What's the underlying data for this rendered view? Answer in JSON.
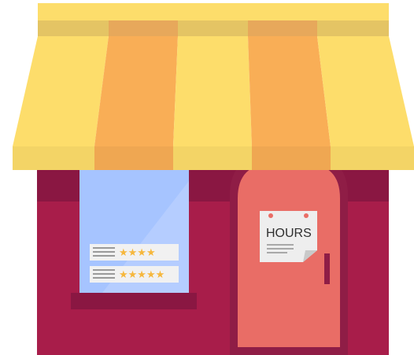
{
  "storefront": {
    "hours_sign": {
      "label": "HOURS"
    },
    "reviews": [
      {
        "stars_shown": "★★★★",
        "rating": 4
      },
      {
        "stars_shown": "★★★★★",
        "rating": 5
      }
    ]
  },
  "colors": {
    "awning_yellow": "#FDDD6B",
    "awning_orange": "#F9AE56",
    "awning_valance": "#E4C464",
    "wall": "#A81D4A",
    "wall_trim": "#8A1742",
    "door": "#E96D66",
    "door_frame": "#8F1D46",
    "window_glass": "#A6C4FF",
    "window_sill": "#8A1742",
    "sign_paper": "#EEEEEE",
    "star": "#F6B73C"
  }
}
